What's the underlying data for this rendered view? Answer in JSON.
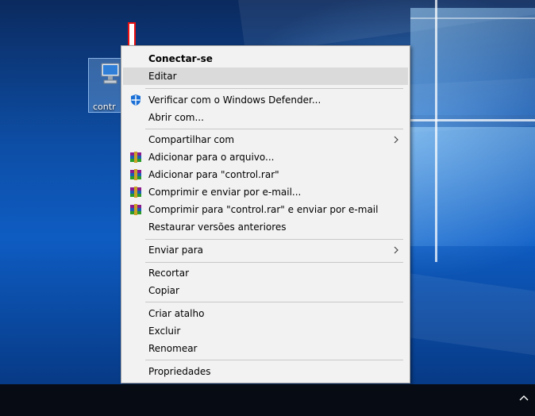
{
  "desktop": {
    "icon": {
      "label": "contr",
      "icon": "monitor-icon"
    }
  },
  "context_menu": {
    "items": [
      {
        "label": "Conectar-se",
        "bold": true
      },
      {
        "label": "Editar"
      },
      {
        "label": "Verificar com o Windows Defender...",
        "icon": "windows-defender-shield-icon"
      },
      {
        "label": "Abrir com..."
      },
      {
        "label": "Compartilhar com",
        "submenu": true
      },
      {
        "label": "Adicionar para o arquivo...",
        "icon": "winrar-icon"
      },
      {
        "label": "Adicionar para \"control.rar\"",
        "icon": "winrar-icon"
      },
      {
        "label": "Comprimir e enviar por e-mail...",
        "icon": "winrar-icon"
      },
      {
        "label": "Comprimir para \"control.rar\" e enviar por e-mail",
        "icon": "winrar-icon"
      },
      {
        "label": "Restaurar versões anteriores"
      },
      {
        "label": "Enviar para",
        "submenu": true
      },
      {
        "label": "Recortar"
      },
      {
        "label": "Copiar"
      },
      {
        "label": "Criar atalho"
      },
      {
        "label": "Excluir"
      },
      {
        "label": "Renomear"
      },
      {
        "label": "Propriedades"
      }
    ],
    "highlighted_item": "Editar"
  },
  "annotation": {
    "icon": "red-down-arrow-icon",
    "color": "#e81010"
  },
  "taskbar": {
    "tray_icon": "chevron-up-icon"
  },
  "colors": {
    "menu_bg": "#f2f2f2",
    "highlight": "#dadada",
    "defender_blue": "#1a6fd6"
  }
}
